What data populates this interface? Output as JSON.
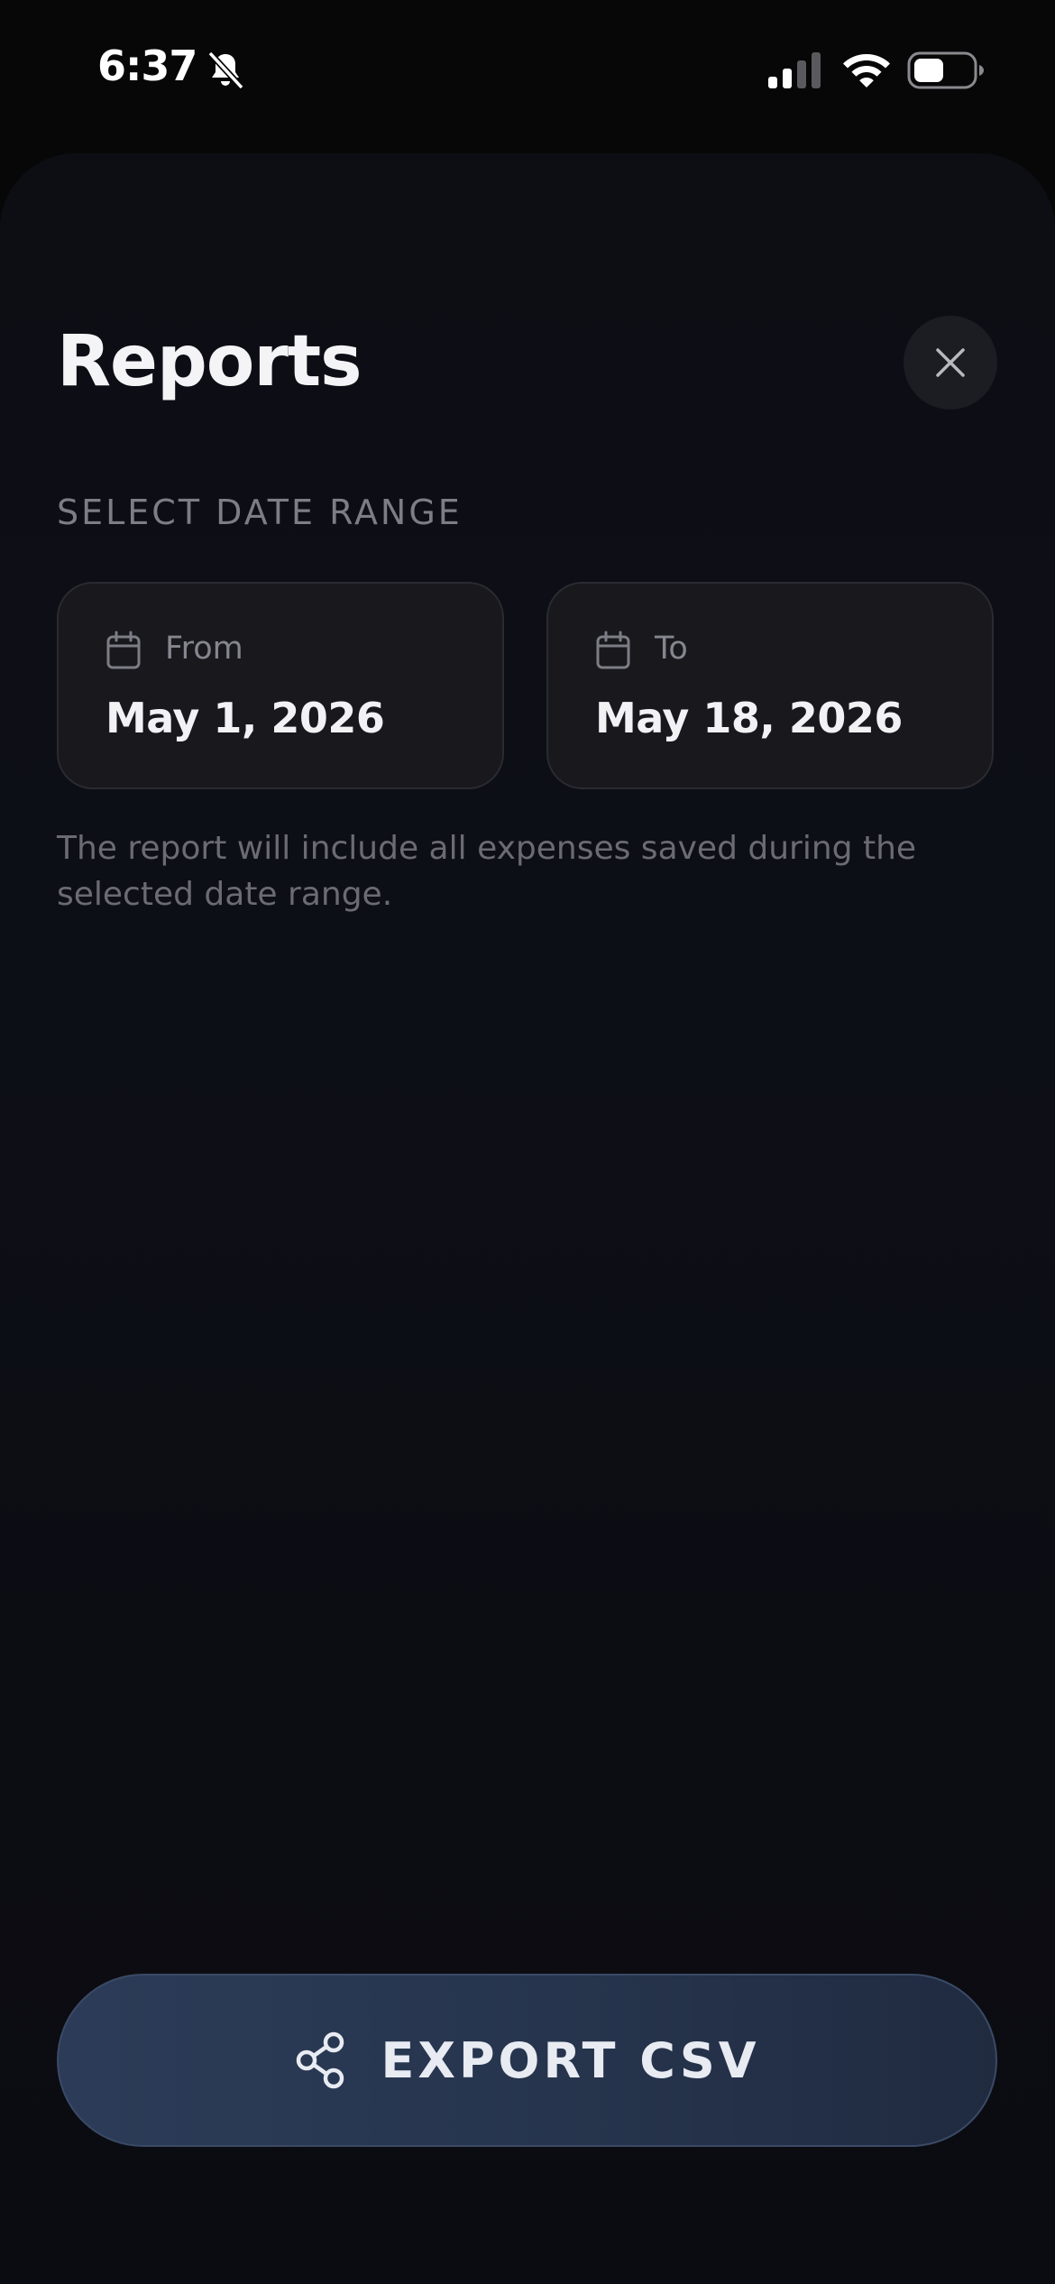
{
  "status_bar": {
    "time": "6:37",
    "icons": [
      "bell-muted-icon",
      "cellular-signal-icon",
      "wifi-icon",
      "battery-icon"
    ]
  },
  "sheet": {
    "title": "Reports",
    "close_icon": "close-icon",
    "section_label": "SELECT DATE RANGE",
    "from": {
      "label": "From",
      "value": "May 1, 2026",
      "icon": "calendar-icon"
    },
    "to": {
      "label": "To",
      "value": "May 18, 2026",
      "icon": "calendar-icon"
    },
    "hint": "The report will include all expenses saved during the selected date range.",
    "export": {
      "label": "EXPORT CSV",
      "icon": "share-icon"
    }
  },
  "colors": {
    "background": "#0d0e14",
    "card": "#18181d",
    "accent_button": "#2c3c58",
    "text_primary": "#f4f4f6",
    "text_secondary": "#7c7d85"
  }
}
